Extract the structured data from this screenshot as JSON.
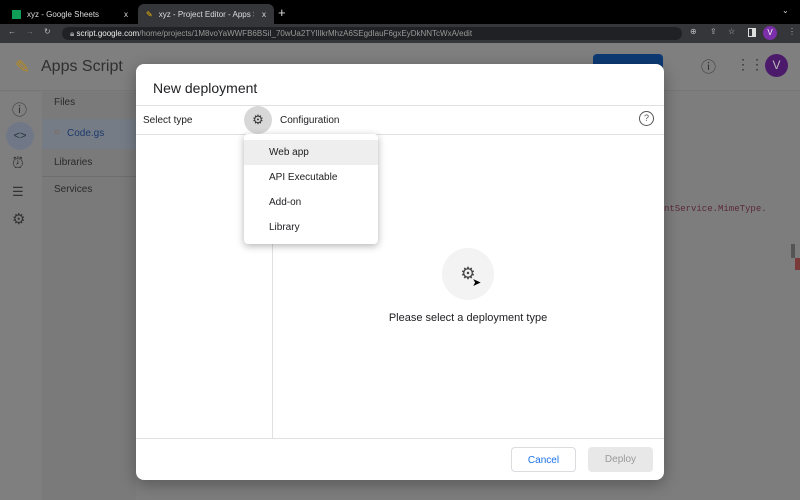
{
  "browser": {
    "tabs": [
      {
        "title": "xyz - Google Sheets",
        "close": "x"
      },
      {
        "title": "xyz - Project Editor - Apps Scri",
        "close": "x"
      }
    ],
    "new_tab": "+",
    "url_host": "script.google.com",
    "url_path": "/home/projects/1M8voYaWWFB6BSiI_70wUa2TYIllkrMhzA6SEgdIauF6gxEyDkNNTcWxA/edit",
    "profile_initial": "V"
  },
  "app": {
    "name": "Apps Script",
    "avatar": "V",
    "code_snippet": "ntService.MimeType.",
    "sidebar": {
      "files_label": "Files",
      "file": "Code.gs",
      "libraries": "Libraries",
      "services": "Services"
    }
  },
  "dialog": {
    "title": "New deployment",
    "select_type": "Select type",
    "configuration": "Configuration",
    "menu": [
      "Web app",
      "API Executable",
      "Add-on",
      "Library"
    ],
    "placeholder": "Please select a deployment type",
    "cancel": "Cancel",
    "deploy": "Deploy"
  },
  "colors": {
    "accent": "#1a73e8",
    "avatar": "#7b1fa2"
  }
}
